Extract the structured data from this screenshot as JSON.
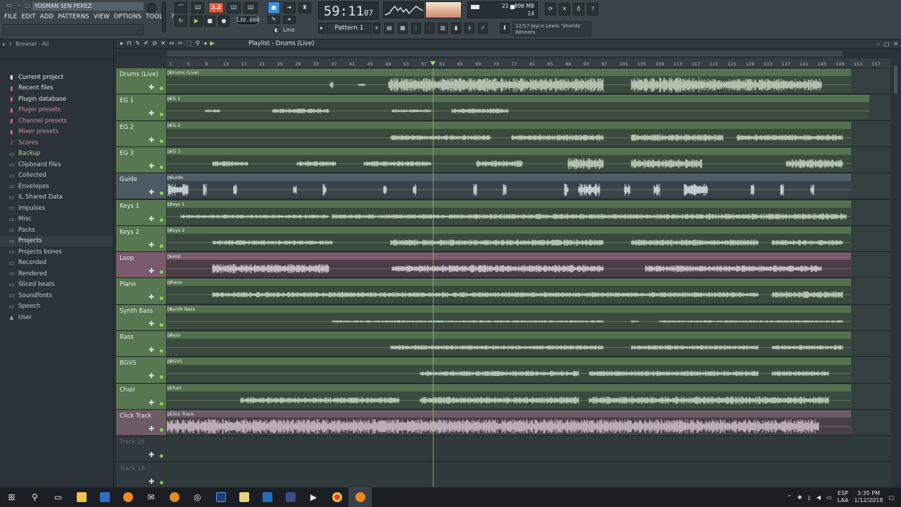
{
  "window": {
    "title": "YOSMAN SEN PEREZ"
  },
  "menu": [
    "FILE",
    "EDIT",
    "ADD",
    "PATTERNS",
    "VIEW",
    "OPTIONS",
    "TOOLS",
    "?"
  ],
  "transport": {
    "pat_song": "3.2",
    "time_main": "59:11",
    "time_sub": "07",
    "tempo": "130.000",
    "pattern": "Pattern 1",
    "snap": "Line"
  },
  "meters": {
    "cpu": "21",
    "memory": "896 MB",
    "polyphony": "14"
  },
  "news": {
    "line1": "12/17 Jayce Lewis 'Shields'",
    "line2": "Winners"
  },
  "browser": {
    "title": "Browser - All",
    "items": [
      {
        "label": "Current project",
        "icon": "▮",
        "kind": "special first"
      },
      {
        "label": "Recent files",
        "icon": "▮",
        "kind": "special recent"
      },
      {
        "label": "Plugin database",
        "icon": "▮",
        "kind": "special recent"
      },
      {
        "label": "Plugin presets",
        "icon": "▮",
        "kind": "special pink"
      },
      {
        "label": "Channel presets",
        "icon": "▮",
        "kind": "special pink"
      },
      {
        "label": "Mixer presets",
        "icon": "▮",
        "kind": "special pink"
      },
      {
        "label": "Scores",
        "icon": "♪",
        "kind": "special pink"
      },
      {
        "label": "Backup",
        "icon": "▭",
        "kind": "folder green"
      },
      {
        "label": "Clipboard files",
        "icon": "▭",
        "kind": "folder"
      },
      {
        "label": "Collected",
        "icon": "▭",
        "kind": "folder"
      },
      {
        "label": "Envelopes",
        "icon": "▭",
        "kind": "folder"
      },
      {
        "label": "IL Shared Data",
        "icon": "▭",
        "kind": "folder"
      },
      {
        "label": "Impulses",
        "icon": "▭",
        "kind": "folder"
      },
      {
        "label": "Misc",
        "icon": "▭",
        "kind": "folder"
      },
      {
        "label": "Packs",
        "icon": "▭",
        "kind": "folder"
      },
      {
        "label": "Projects",
        "icon": "▭",
        "kind": "folder active"
      },
      {
        "label": "Projects bones",
        "icon": "▭",
        "kind": "folder"
      },
      {
        "label": "Recorded",
        "icon": "▭",
        "kind": "folder"
      },
      {
        "label": "Rendered",
        "icon": "▭",
        "kind": "folder"
      },
      {
        "label": "Sliced beats",
        "icon": "▭",
        "kind": "folder"
      },
      {
        "label": "Soundfonts",
        "icon": "▭",
        "kind": "folder"
      },
      {
        "label": "Speech",
        "icon": "▭",
        "kind": "folder"
      },
      {
        "label": "User",
        "icon": "▲",
        "kind": "folder"
      }
    ]
  },
  "playlist": {
    "title": "Playlist - Drums (Live)",
    "ruler": [
      "1",
      "5",
      "9",
      "13",
      "17",
      "21",
      "25",
      "29",
      "33",
      "37",
      "41",
      "45",
      "49",
      "53",
      "57",
      "61",
      "65",
      "69",
      "73",
      "77",
      "81",
      "85",
      "89",
      "93",
      "97",
      "101",
      "105",
      "109",
      "113",
      "117",
      "121",
      "125",
      "129",
      "133",
      "137",
      "141",
      "145",
      "149",
      "153",
      "157"
    ],
    "playhead_bar": 60,
    "tracks": [
      {
        "name": "Drums (Live)",
        "clip": "Drums (Live)",
        "style": "audio",
        "segs": [
          [
            232,
            236,
            0.5
          ],
          [
            272,
            282,
            0.15
          ],
          [
            315,
            620,
            0.9
          ],
          [
            660,
            760,
            1
          ],
          [
            760,
            930,
            0.8
          ]
        ]
      },
      {
        "name": "EG 1",
        "clip": "EG 1",
        "style": "audio long",
        "segs": [
          [
            55,
            75,
            0.2
          ],
          [
            150,
            230,
            0.3
          ],
          [
            320,
            375,
            0.2
          ],
          [
            405,
            485,
            0.3
          ]
        ]
      },
      {
        "name": "EG 2",
        "clip": "EG 2",
        "style": "audio",
        "segs": [
          [
            318,
            460,
            0.35
          ],
          [
            490,
            620,
            0.4
          ],
          [
            660,
            790,
            0.45
          ],
          [
            810,
            960,
            0.4
          ]
        ]
      },
      {
        "name": "EG 3",
        "clip": "EG 3",
        "style": "audio",
        "segs": [
          [
            65,
            115,
            0.35
          ],
          [
            185,
            240,
            0.35
          ],
          [
            280,
            375,
            0.35
          ],
          [
            440,
            505,
            0.45
          ],
          [
            570,
            620,
            0.75
          ],
          [
            660,
            760,
            0.6
          ],
          [
            880,
            960,
            0.6
          ]
        ]
      },
      {
        "name": "Guide",
        "clip": "Guide",
        "style": "guide",
        "segs": [
          [
            2,
            30,
            0.8
          ],
          [
            52,
            56,
            0.8
          ],
          [
            95,
            99,
            0.8
          ],
          [
            180,
            184,
            0.8
          ],
          [
            222,
            226,
            0.8
          ],
          [
            308,
            312,
            0.8
          ],
          [
            350,
            354,
            0.8
          ],
          [
            436,
            440,
            0.8
          ],
          [
            478,
            482,
            0.8
          ],
          [
            565,
            570,
            0.8
          ],
          [
            585,
            615,
            0.8
          ],
          [
            650,
            658,
            0.8
          ],
          [
            692,
            700,
            0.8
          ],
          [
            735,
            768,
            0.8
          ],
          [
            830,
            834,
            0.8
          ],
          [
            872,
            876,
            0.8
          ],
          [
            915,
            919,
            0.8
          ]
        ]
      },
      {
        "name": "Keys 1",
        "clip": "Keys 1",
        "style": "audio",
        "segs": [
          [
            20,
            230,
            0.25
          ],
          [
            235,
            440,
            0.3
          ],
          [
            440,
            620,
            0.35
          ],
          [
            620,
            760,
            0.35
          ],
          [
            760,
            965,
            0.4
          ]
        ]
      },
      {
        "name": "Keys 2",
        "clip": "Keys 2",
        "style": "audio",
        "segs": [
          [
            65,
            235,
            0.3
          ],
          [
            318,
            620,
            0.4
          ],
          [
            660,
            840,
            0.4
          ],
          [
            860,
            960,
            0.35
          ]
        ]
      },
      {
        "name": "Loop",
        "clip": "Loop",
        "style": "loop",
        "segs": [
          [
            65,
            230,
            0.6
          ],
          [
            320,
            620,
            0.5
          ],
          [
            680,
            930,
            0.45
          ]
        ]
      },
      {
        "name": "Piano",
        "clip": "Piano",
        "style": "audio",
        "segs": [
          [
            65,
            840,
            0.35
          ],
          [
            860,
            960,
            0.45
          ]
        ]
      },
      {
        "name": "Synth Bass",
        "clip": "Synth Bass",
        "style": "audio",
        "segs": [
          [
            235,
            620,
            0.15
          ],
          [
            660,
            670,
            0.15
          ],
          [
            700,
            960,
            0.15
          ]
        ]
      },
      {
        "name": "Bass",
        "clip": "Bass",
        "style": "audio",
        "segs": [
          [
            318,
            620,
            0.3
          ],
          [
            660,
            840,
            0.3
          ],
          [
            860,
            960,
            0.3
          ]
        ]
      },
      {
        "name": "BGVS",
        "clip": "BGVS",
        "style": "audio",
        "segs": [
          [
            360,
            585,
            0.35
          ],
          [
            600,
            840,
            0.35
          ],
          [
            860,
            940,
            0.35
          ]
        ]
      },
      {
        "name": "Choir",
        "clip": "Choir",
        "style": "audio",
        "segs": [
          [
            105,
            330,
            0.4
          ],
          [
            360,
            585,
            0.45
          ],
          [
            600,
            940,
            0.5
          ]
        ]
      },
      {
        "name": "Click Track",
        "clip": "Click Track",
        "style": "click",
        "segs": [
          [
            0,
            926,
            0.95
          ]
        ]
      },
      {
        "name": "Track 15",
        "clip": "",
        "style": "empty",
        "segs": []
      },
      {
        "name": "Track 16",
        "clip": "",
        "style": "empty",
        "segs": []
      }
    ]
  },
  "taskbar": {
    "lang_top": "ESP",
    "lang_bottom": "LAA",
    "time": "3:35 PM",
    "date": "1/12/2018"
  }
}
